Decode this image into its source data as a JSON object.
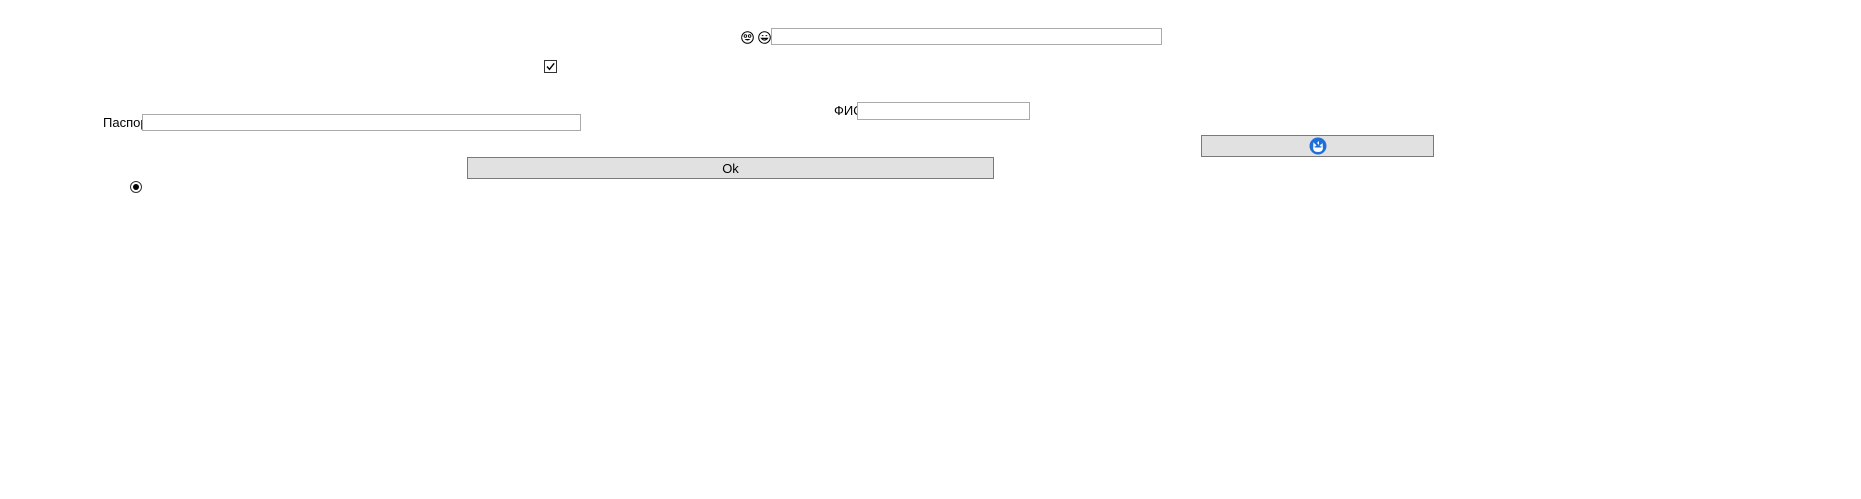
{
  "top_row": {
    "icons": [
      "smiley-face-icon",
      "grinning-face-icon"
    ],
    "input_value": "",
    "input_placeholder": ""
  },
  "agree_checkbox": {
    "checked": true
  },
  "fio": {
    "label": "ФИО",
    "value": ""
  },
  "passport": {
    "label": "Паспорт",
    "value": ""
  },
  "icon_button": {
    "icon": "blue-round-refresh-icon",
    "accent_color": "#1e6fd9"
  },
  "ok_button": {
    "label": "Ok"
  },
  "option_radio": {
    "selected": true
  }
}
